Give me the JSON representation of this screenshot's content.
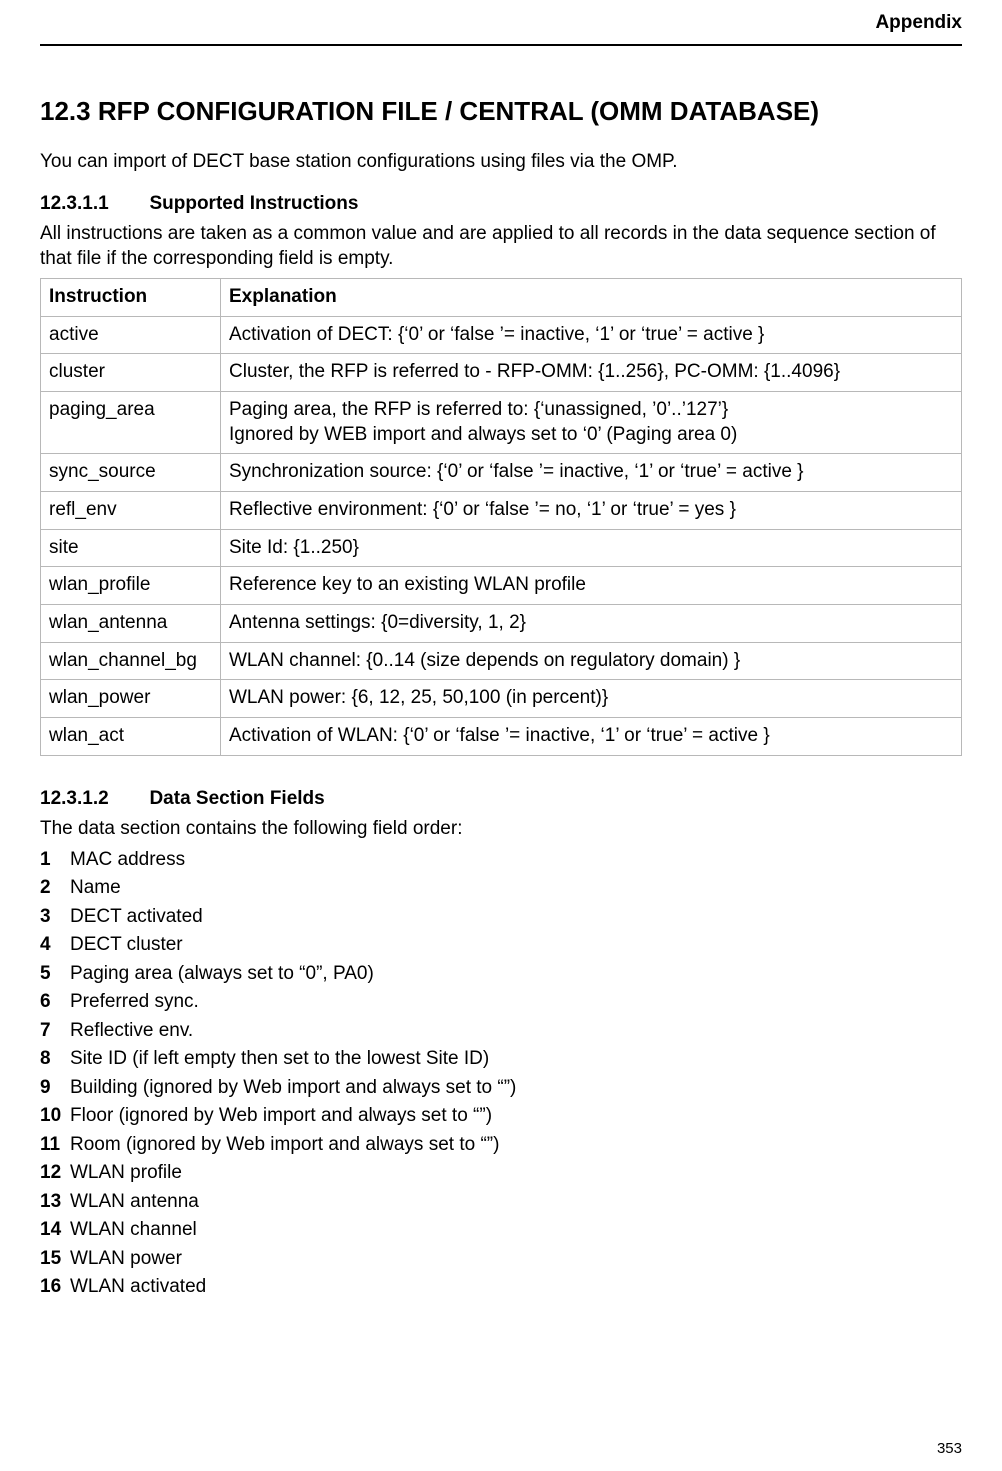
{
  "header": {
    "label": "Appendix"
  },
  "section": {
    "heading": "12.3 RFP CONFIGURATION FILE / CENTRAL (OMM DATABASE)",
    "intro": "You can import of DECT base station configurations using files via the OMP."
  },
  "sub1": {
    "num": "12.3.1.1",
    "title": "Supported Instructions",
    "intro": "All instructions are taken as a common value and are applied to all records in the data sequence section of that file if the corresponding field is empty.",
    "table_headers": {
      "c0": "Instruction",
      "c1": "Explanation"
    },
    "rows": [
      {
        "c0": "active",
        "c1": "Activation of DECT: {‘0’ or ‘false ’= inactive, ‘1’ or ‘true’ = active }"
      },
      {
        "c0": "cluster",
        "c1": "Cluster, the RFP is referred to - RFP-OMM: {1..256}, PC-OMM: {1..4096}"
      },
      {
        "c0": "paging_area",
        "c1": "Paging area, the RFP is referred to: {‘unassigned, ’0’..’127’}\nIgnored by WEB import and always set to ‘0’ (Paging area 0)"
      },
      {
        "c0": "sync_source",
        "c1": "Synchronization source: {‘0’ or ‘false ’= inactive, ‘1’ or ‘true’ = active }"
      },
      {
        "c0": "refl_env",
        "c1": "Reflective environment: {‘0’ or ‘false ’= no, ‘1’ or ‘true’ = yes }"
      },
      {
        "c0": "site",
        "c1": "Site Id: {1..250}"
      },
      {
        "c0": "wlan_profile",
        "c1": "Reference key to an existing WLAN profile"
      },
      {
        "c0": "wlan_antenna",
        "c1": "Antenna settings: {0=diversity, 1, 2}"
      },
      {
        "c0": "wlan_channel_bg",
        "c1": "WLAN channel: {0..14 (size depends on regulatory domain) }"
      },
      {
        "c0": "wlan_power",
        "c1": "WLAN power: {6, 12, 25, 50,100 (in percent)}"
      },
      {
        "c0": "wlan_act",
        "c1": "Activation of WLAN: {‘0’ or ‘false ’= inactive, ‘1’ or ‘true’ = active }"
      }
    ]
  },
  "sub2": {
    "num": "12.3.1.2",
    "title": "Data Section Fields",
    "intro": "The data section contains the following field order:",
    "items": [
      "MAC address",
      "Name",
      "DECT activated",
      "DECT cluster",
      "Paging area (always set to “0”, PA0)",
      "Preferred sync.",
      "Reflective env.",
      "Site ID (if left empty then set to the lowest Site ID)",
      "Building (ignored by Web import and always set to “”)",
      "Floor (ignored by Web import and always set to “”)",
      "Room (ignored by Web import and always set to “”)",
      "WLAN profile",
      "WLAN antenna",
      "WLAN channel",
      "WLAN power",
      "WLAN activated"
    ]
  },
  "page_number": "353"
}
